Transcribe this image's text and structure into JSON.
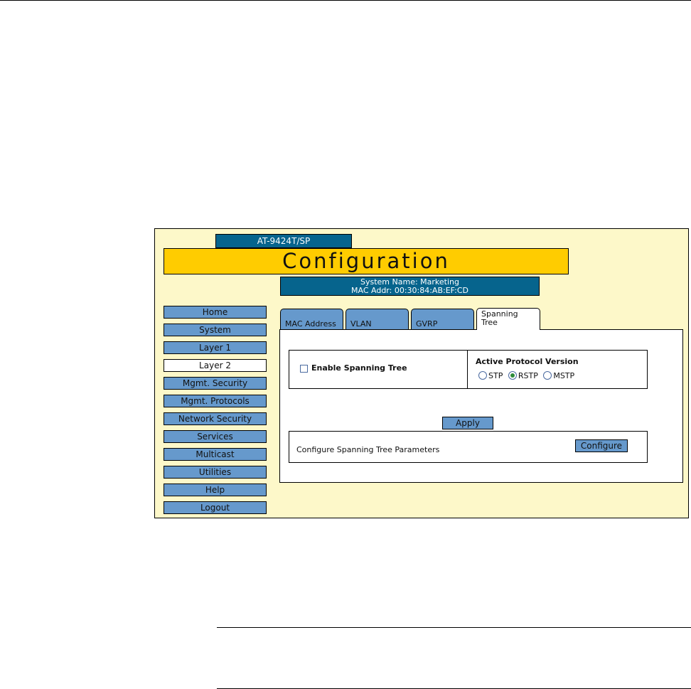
{
  "header": {
    "model": "AT-9424T/SP",
    "title": "Configuration",
    "system_name": "System Name: Marketing",
    "mac_addr": "MAC Addr: 00:30:84:AB:EF:CD"
  },
  "sidebar": {
    "items": [
      {
        "label": "Home"
      },
      {
        "label": "System"
      },
      {
        "label": "Layer 1"
      },
      {
        "label": "Layer 2"
      },
      {
        "label": "Mgmt. Security"
      },
      {
        "label": "Mgmt. Protocols"
      },
      {
        "label": "Network Security"
      },
      {
        "label": "Services"
      },
      {
        "label": "Multicast"
      },
      {
        "label": "Utilities"
      },
      {
        "label": "Help"
      },
      {
        "label": "Logout"
      }
    ],
    "active": "Layer 2"
  },
  "tabs": [
    {
      "label": "MAC Address"
    },
    {
      "label": "VLAN"
    },
    {
      "label": "GVRP"
    },
    {
      "label_line1": "Spanning",
      "label_line2": "Tree"
    }
  ],
  "active_tab": "Spanning Tree",
  "spanning_tree": {
    "enable_label": "Enable Spanning Tree",
    "enabled": false,
    "protocol_title": "Active Protocol Version",
    "protocols": [
      "STP",
      "RSTP",
      "MSTP"
    ],
    "selected_protocol": "RSTP",
    "apply_label": "Apply",
    "configure_text": "Configure Spanning Tree Parameters",
    "configure_label": "Configure"
  },
  "colors": {
    "frame_bg": "#fdf8c9",
    "title_band": "#ffcc00",
    "header_blue": "#06648d",
    "button_blue": "#6699cc"
  }
}
